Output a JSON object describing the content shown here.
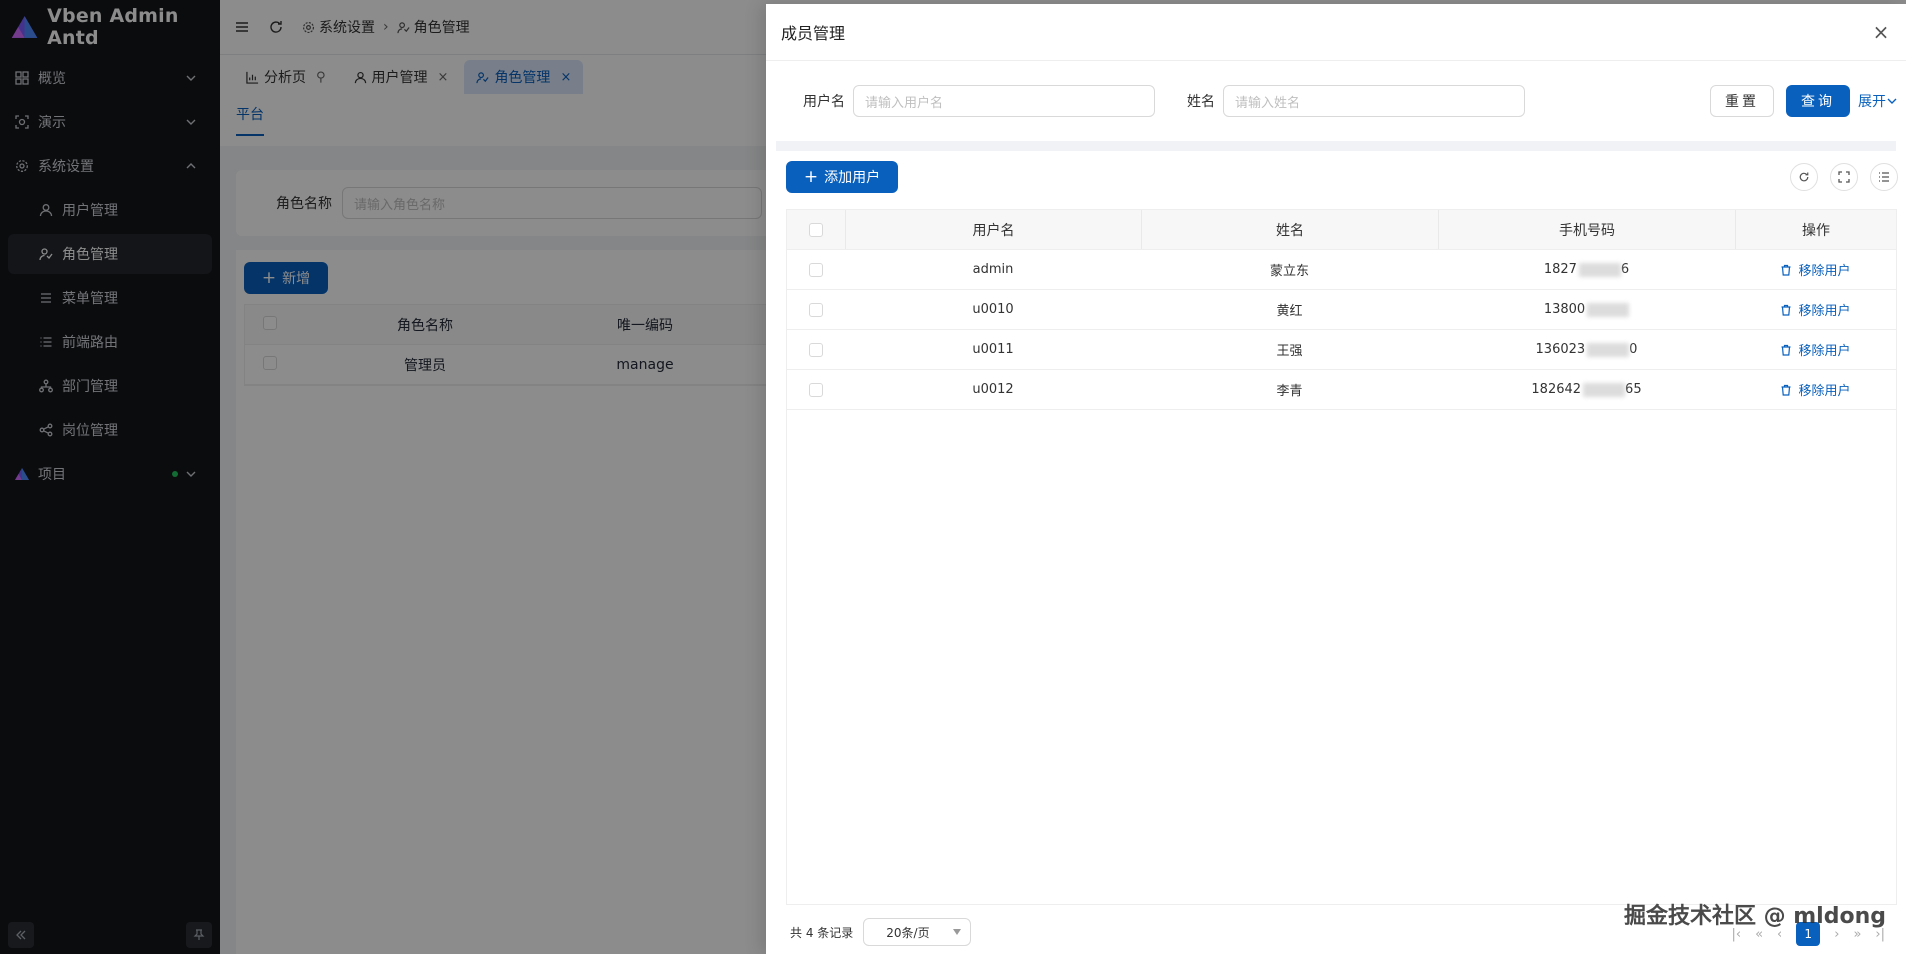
{
  "app": {
    "title": "Vben Admin Antd"
  },
  "sidebar": {
    "items": [
      {
        "label": "概览",
        "icon": "dashboard-icon",
        "state": "collapsed"
      },
      {
        "label": "演示",
        "icon": "demo-icon",
        "state": "collapsed"
      },
      {
        "label": "系统设置",
        "icon": "gear-icon",
        "state": "expanded"
      },
      {
        "label": "用户管理",
        "icon": "user-icon"
      },
      {
        "label": "角色管理",
        "icon": "role-icon",
        "active": true
      },
      {
        "label": "菜单管理",
        "icon": "menu-icon"
      },
      {
        "label": "前端路由",
        "icon": "list-icon"
      },
      {
        "label": "部门管理",
        "icon": "org-icon"
      },
      {
        "label": "岗位管理",
        "icon": "share-icon"
      },
      {
        "label": "项目",
        "icon": "vben-logo-icon",
        "state": "collapsed",
        "badge": "green-dot"
      }
    ]
  },
  "header": {
    "breadcrumb": [
      "系统设置",
      "角色管理"
    ]
  },
  "tabs": [
    {
      "label": "分析页",
      "icon": "chart-icon",
      "pinned": true
    },
    {
      "label": "用户管理",
      "icon": "user-icon",
      "closable": true
    },
    {
      "label": "角色管理",
      "icon": "role-icon",
      "closable": true,
      "active": true
    }
  ],
  "subtabs": [
    {
      "label": "平台",
      "active": true
    }
  ],
  "role_page": {
    "search_label": "角色名称",
    "search_placeholder": "请输入角色名称",
    "new_button": "新增",
    "columns": [
      "角色名称",
      "唯一编码"
    ],
    "rows": [
      {
        "name": "管理员",
        "code": "manage"
      }
    ]
  },
  "drawer": {
    "title": "成员管理",
    "close": "×",
    "search": {
      "username_label": "用户名",
      "username_placeholder": "请输入用户名",
      "name_label": "姓名",
      "name_placeholder": "请输入姓名",
      "reset": "重置",
      "query": "查询",
      "expand": "展开"
    },
    "add_button": "添加用户",
    "columns": [
      "用户名",
      "姓名",
      "手机号码",
      "操作"
    ],
    "rows": [
      {
        "username": "admin",
        "name": "蒙立东",
        "phone_start": "1827",
        "phone_end": "6",
        "action": "移除用户"
      },
      {
        "username": "u0010",
        "name": "黄红",
        "phone_start": "13800",
        "phone_end": "",
        "action": "移除用户"
      },
      {
        "username": "u0011",
        "name": "王强",
        "phone_start": "136023",
        "phone_end": "0",
        "action": "移除用户"
      },
      {
        "username": "u0012",
        "name": "李青",
        "phone_start": "182642",
        "phone_end": "65",
        "action": "移除用户"
      }
    ],
    "pagination": {
      "total_text": "共 4 条记录",
      "page_size": "20条/页",
      "current_page": "1"
    }
  },
  "watermark": "掘金技术社区 @ mldong",
  "colors": {
    "primary": "#0960bd",
    "sidebar_bg": "#14161a"
  }
}
